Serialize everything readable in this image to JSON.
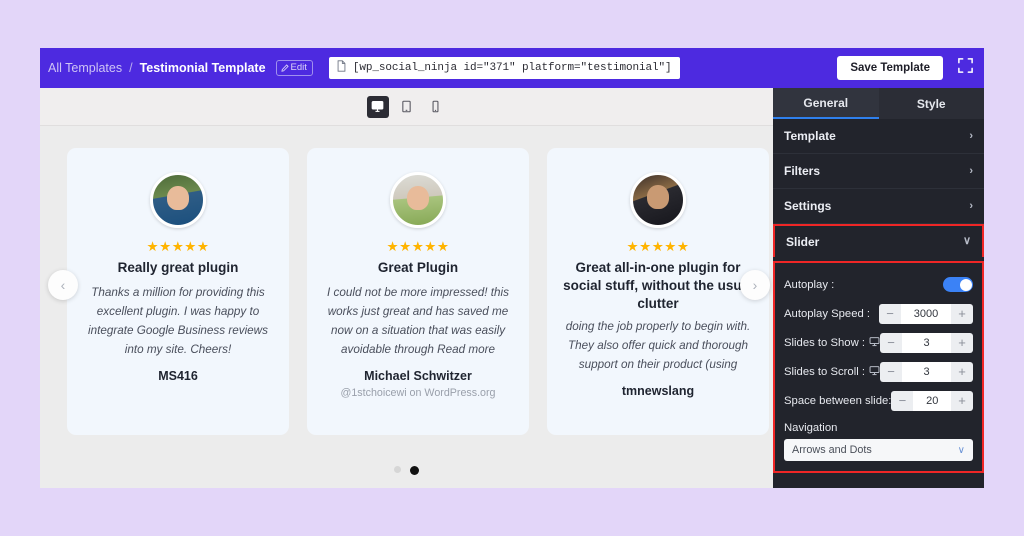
{
  "header": {
    "breadcrumb_root": "All Templates",
    "breadcrumb_sep": "/",
    "breadcrumb_current": "Testimonial Template",
    "edit_label": "Edit",
    "shortcode": "[wp_social_ninja id=\"371\" platform=\"testimonial\"]",
    "save_label": "Save Template",
    "bg_color": "#4d2ae0"
  },
  "devices": [
    {
      "name": "desktop",
      "active": true
    },
    {
      "name": "tablet",
      "active": false
    },
    {
      "name": "mobile",
      "active": false
    }
  ],
  "slider": {
    "prev_arrow": "‹",
    "next_arrow": "›",
    "dots": [
      {
        "active": false
      },
      {
        "active": true
      }
    ],
    "cards": [
      {
        "stars": "★★★★★",
        "title": "Really great plugin",
        "body": "Thanks a million for providing this excellent plugin. I was happy to integrate Google Business reviews into my site. Cheers!",
        "author": "MS416",
        "handle": ""
      },
      {
        "stars": "★★★★★",
        "title": "Great Plugin",
        "body": "I could not be more impressed! this works just great and has saved me now on a situation that was easily avoidable through Read more",
        "author": "Michael Schwitzer",
        "handle": "@1stchoicewi on WordPress.org"
      },
      {
        "stars": "★★★★★",
        "title": "Great all-in-one plugin for social stuff, without the usual clutter",
        "body": "doing the job properly to begin with. They also offer quick and thorough support on their product (using",
        "author": "tmnewslang",
        "handle": ""
      }
    ]
  },
  "panel": {
    "tabs": [
      {
        "label": "General",
        "active": true
      },
      {
        "label": "Style",
        "active": false
      }
    ],
    "accordion": [
      {
        "label": "Template",
        "chevron": "›",
        "highlighted": false
      },
      {
        "label": "Filters",
        "chevron": "›",
        "highlighted": false
      },
      {
        "label": "Settings",
        "chevron": "›",
        "highlighted": false
      },
      {
        "label": "Slider",
        "chevron": "∨",
        "highlighted": true
      }
    ],
    "settings": {
      "autoplay_label": "Autoplay :",
      "autoplay_on": true,
      "autoplay_speed_label": "Autoplay Speed :",
      "autoplay_speed_value": "3000",
      "slides_to_show_label": "Slides to Show :",
      "slides_to_show_value": "3",
      "slides_to_scroll_label": "Slides to Scroll :",
      "slides_to_scroll_value": "3",
      "space_between_label": "Space between slide:",
      "space_between_value": "20",
      "minus": "−",
      "plus": "+",
      "navigation_label": "Navigation",
      "navigation_value": "Arrows and Dots",
      "navigation_caret": "∨"
    },
    "accent_color": "#3b82f6",
    "highlight_color": "#ef2626",
    "bg_color": "#22242c"
  }
}
